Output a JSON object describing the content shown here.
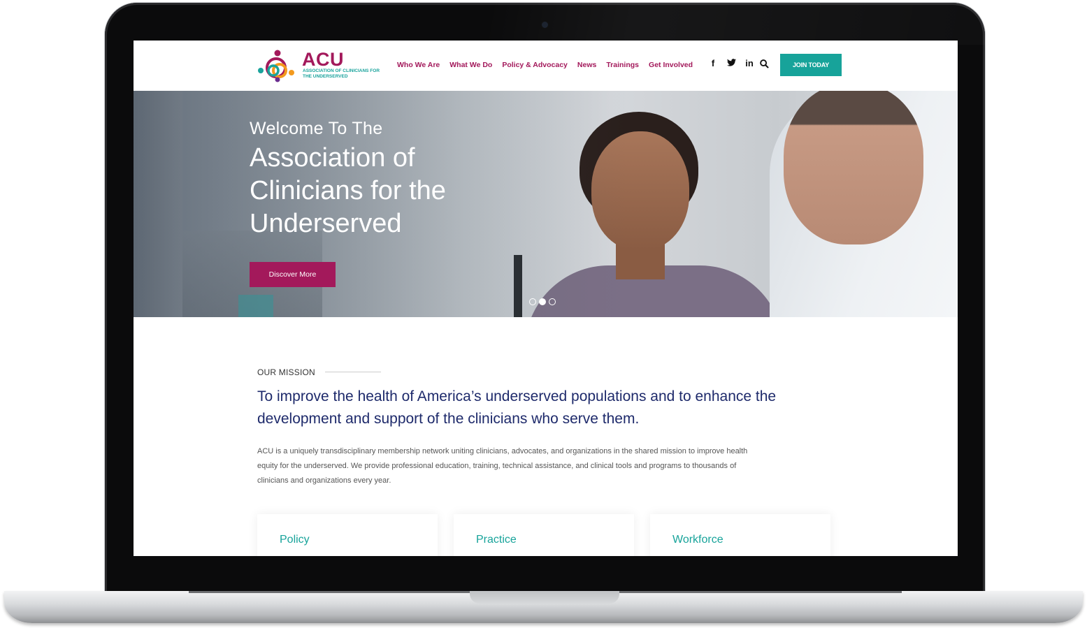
{
  "header": {
    "logo_text": "ACU",
    "logo_subtitle": "Association of Clinicians for the Underserved",
    "nav": [
      "Who We Are",
      "What We Do",
      "Policy & Advocacy",
      "News",
      "Trainings",
      "Get Involved"
    ],
    "social": {
      "facebook": "f",
      "twitter": "🐦",
      "linkedin": "in"
    },
    "join_label": "JOIN TODAY"
  },
  "hero": {
    "pre_title": "Welcome To The",
    "title": "Association of Clinicians for the Underserved",
    "cta_label": "Discover More",
    "slide_count": 3,
    "active_slide": 2
  },
  "mission": {
    "label": "OUR MISSION",
    "heading": "To improve the health of America’s underserved populations and to enhance the development and support of the clinicians who serve them.",
    "body": "ACU is a uniquely transdisciplinary membership network uniting clinicians, advocates, and organizations in the shared mission to improve health equity for the underserved. We provide professional education, training, technical assistance, and clinical tools and programs to thousands of clinicians and organizations every year."
  },
  "cards": [
    "Policy",
    "Practice",
    "Workforce"
  ],
  "colors": {
    "brand_magenta": "#a3195b",
    "brand_teal": "#17a39a",
    "heading_navy": "#1e2a6b"
  }
}
